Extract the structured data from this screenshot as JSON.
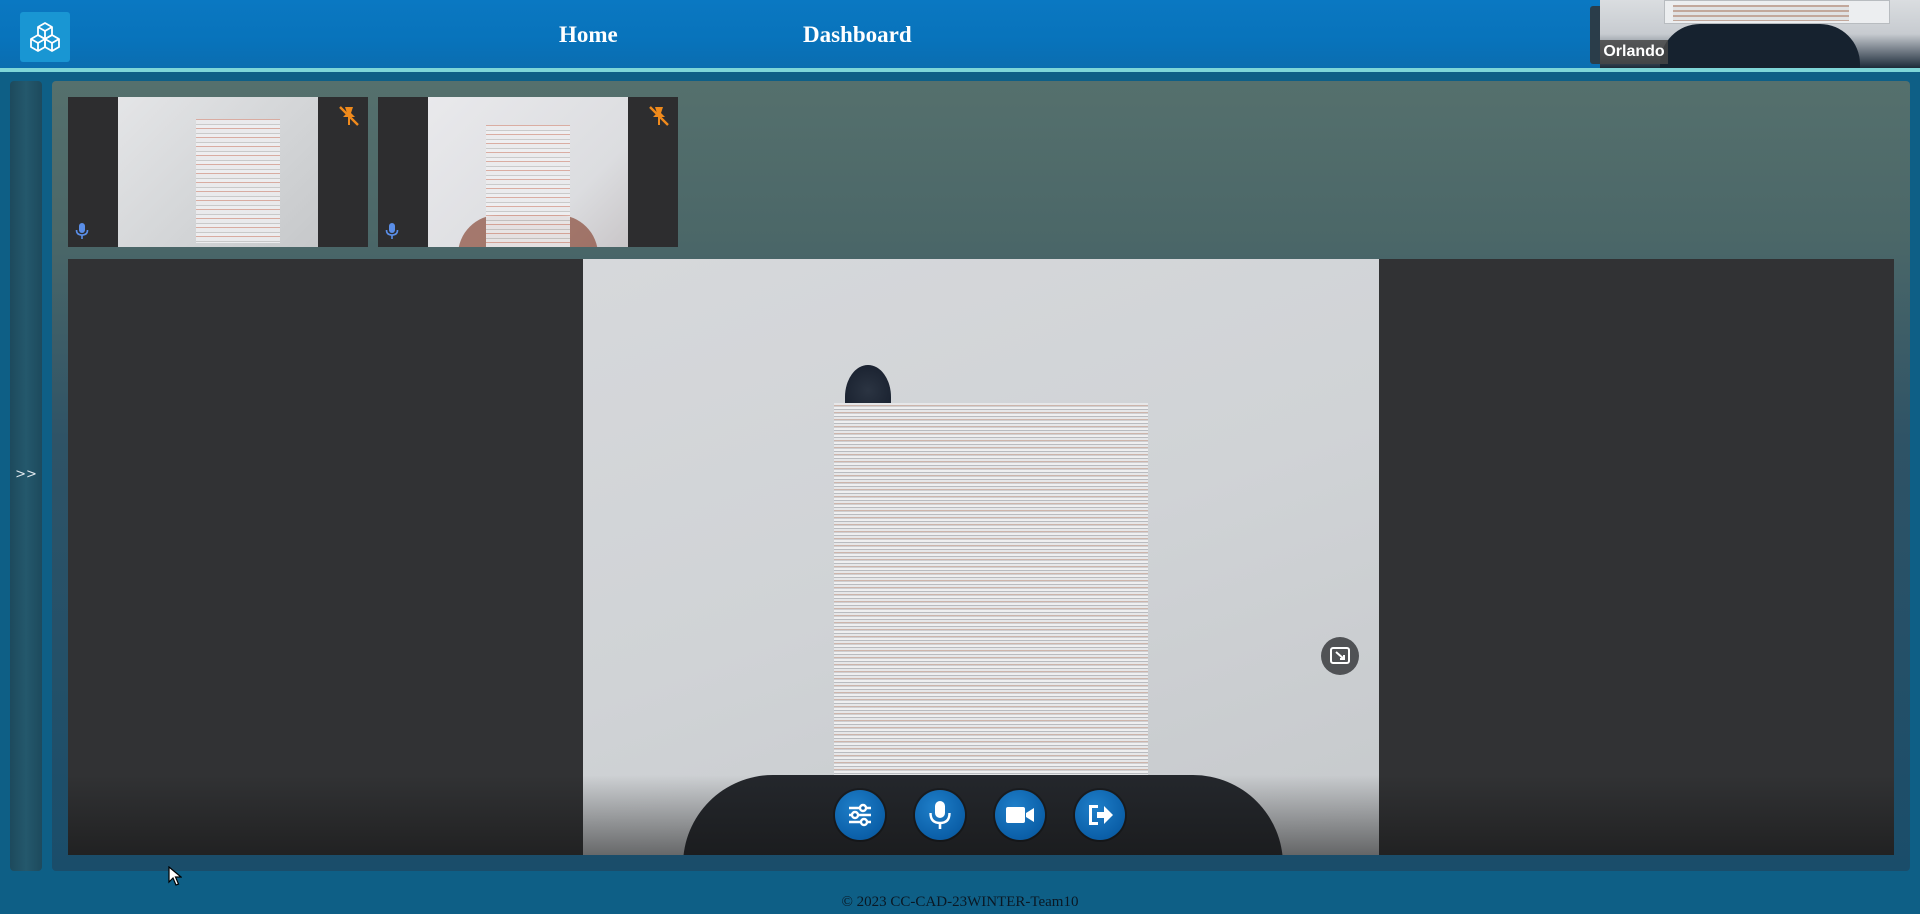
{
  "nav": {
    "home_label": "Home",
    "dashboard_label": "Dashboard"
  },
  "self_view": {
    "name": "Orlando"
  },
  "side_panel": {
    "toggle_label": ">>"
  },
  "thumbnails": [
    {
      "pin_icon": "pin-off-icon",
      "mic_icon": "mic-icon"
    },
    {
      "pin_icon": "pin-off-icon",
      "mic_icon": "mic-icon"
    }
  ],
  "controls": {
    "settings_icon": "sliders-icon",
    "mic_icon": "mic-icon",
    "camera_icon": "video-camera-icon",
    "leave_icon": "sign-out-icon"
  },
  "footer": {
    "text": "© 2023 CC-CAD-23WINTER-Team10"
  },
  "colors": {
    "topbar": "#0873bb",
    "accent_line": "#7ed6d8",
    "control_button": "#0b5fa8",
    "pin": "#f08a1c"
  }
}
